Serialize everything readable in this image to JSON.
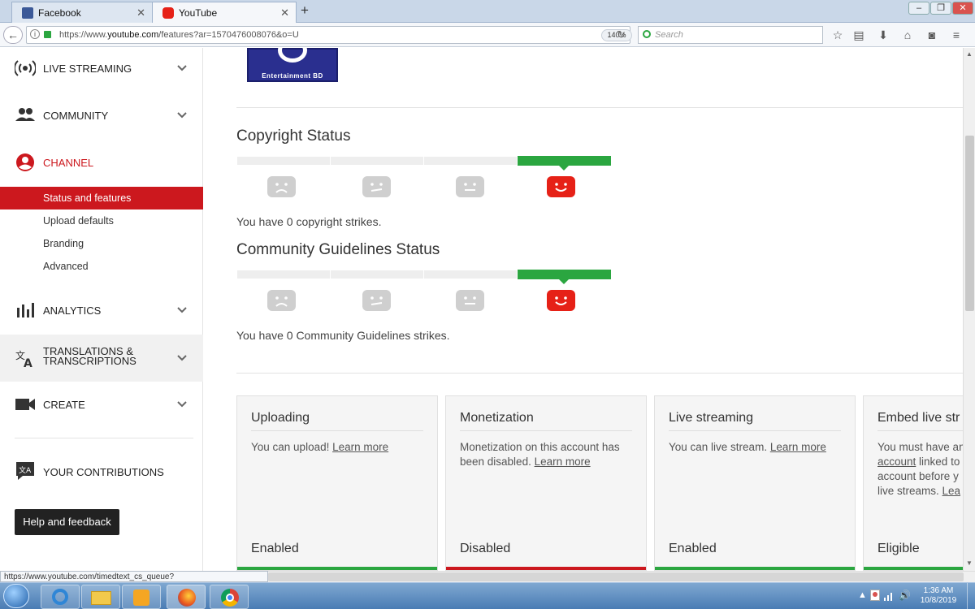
{
  "browser": {
    "tabs": [
      {
        "label": "Facebook",
        "active": false
      },
      {
        "label": "YouTube",
        "active": true
      }
    ],
    "url_prefix": "https://www.",
    "url_host": "youtube.com",
    "url_rest": "/features?ar=1570476008076&o=U",
    "zoom": "140%",
    "search_placeholder": "Search"
  },
  "sidebar": {
    "live_streaming": "LIVE STREAMING",
    "community": "COMMUNITY",
    "channel": "CHANNEL",
    "channel_items": [
      "Status and features",
      "Upload defaults",
      "Branding",
      "Advanced"
    ],
    "analytics": "ANALYTICS",
    "translations_line1": "TRANSLATIONS &",
    "translations_line2": "TRANSCRIPTIONS",
    "create": "CREATE",
    "your_contributions": "YOUR CONTRIBUTIONS",
    "help_button": "Help and feedback"
  },
  "content": {
    "logo_caption": "Entertainment BD",
    "copyright_title": "Copyright Status",
    "copyright_strikes_text": "You have 0 copyright strikes.",
    "copyright_level": 0,
    "community_title": "Community Guidelines Status",
    "community_strikes_text": "You have 0 Community Guidelines strikes.",
    "community_level": 0,
    "cards": [
      {
        "title": "Uploading",
        "text": "You can upload! ",
        "link": "Learn more",
        "status": "Enabled",
        "status_color": "#2ba640"
      },
      {
        "title": "Monetization",
        "text": "Monetization on this account has been disabled. ",
        "link": "Learn more",
        "status": "Disabled",
        "status_color": "#cc181e"
      },
      {
        "title": "Live streaming",
        "text": "You can live stream. ",
        "link": "Learn more",
        "status": "Enabled",
        "status_color": "#2ba640"
      },
      {
        "title": "Embed live str",
        "text": "You must have an ",
        "link": "account",
        "text2": " linked to account before y live streams. ",
        "link2": "Lea",
        "status": "Eligible",
        "status_color": "#2ba640"
      }
    ]
  },
  "status_bar": {
    "hover_url": "https://www.youtube.com/timedtext_cs_queue?ar=1570476090074&o=U"
  },
  "taskbar": {
    "time": "1:36 AM",
    "date": "10/8/2019"
  },
  "colors": {
    "accent": "#cc181e",
    "green": "#2ba640",
    "face_active": "#e62117",
    "face_inactive": "#cfcfcf"
  }
}
